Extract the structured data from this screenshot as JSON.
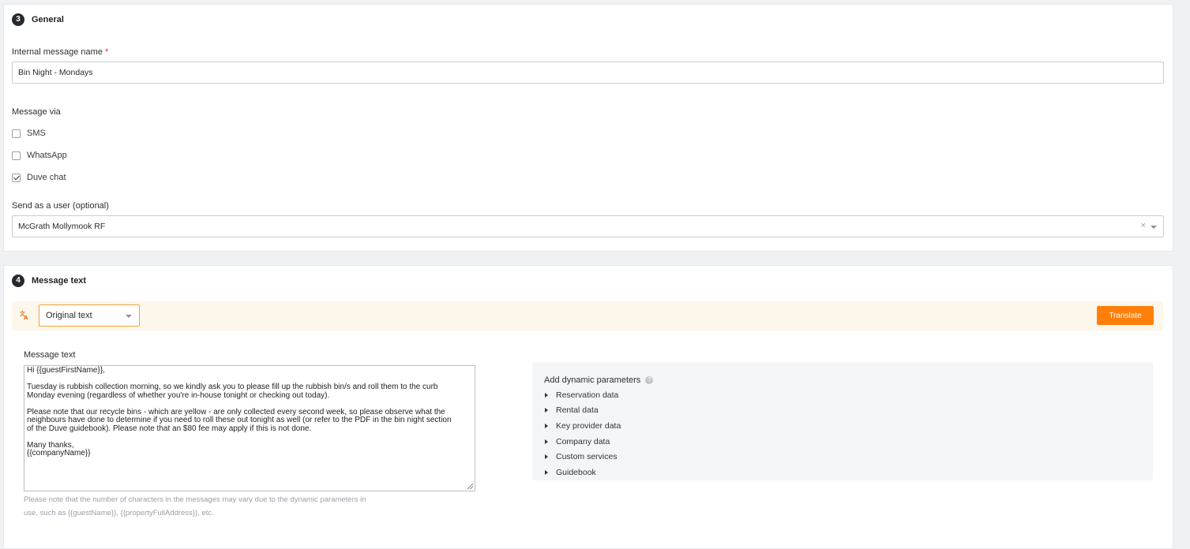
{
  "general": {
    "step": "3",
    "title": "General",
    "name_label": "Internal message name",
    "name_required": "*",
    "name_value": "Bin Night - Mondays",
    "via_label": "Message via",
    "channels": [
      {
        "label": "SMS",
        "checked": false
      },
      {
        "label": "WhatsApp",
        "checked": false
      },
      {
        "label": "Duve chat",
        "checked": true
      }
    ],
    "send_as_label": "Send as a user (optional)",
    "send_as_value": "McGrath Mollymook RF",
    "clear_symbol": "×"
  },
  "message": {
    "step": "4",
    "title": "Message text",
    "translate_icon": "translate-icon",
    "language_value": "Original text",
    "translate_button": "Translate",
    "text_label": "Message text",
    "paragraphs": [
      "Hi {{guestFirstName}},",
      "Tuesday is rubbish collection morning, so we kindly ask you to please fill up the rubbish bin/s and roll them to the curb\nMonday evening (regardless of whether you're in-house tonight or checking out today).",
      "Please note that our recycle bins - which are yellow - are only collected every second week, so please observe what the\nneighbours have done to determine if you need to roll these out tonight as well (or refer to the PDF in the bin night section\nof the Duve guidebook). Please note that an $80 fee may apply if this is not done.",
      "Many thanks,\n{{companyName}}"
    ],
    "note": "Please note that the number of characters in the messages may vary due to the dynamic parameters in use, such as {{guestName}}, {{propertyFullAddress}}, etc.",
    "dynamic_title": "Add dynamic parameters",
    "dynamic_items": [
      "Reservation data",
      "Rental data",
      "Key provider data",
      "Company data",
      "Custom services",
      "Guidebook"
    ]
  },
  "colors": {
    "accent": "#ff7f0a",
    "required": "#e0352f",
    "step_badge": "#262a2e",
    "translate_bar_bg": "#fdf6ea"
  }
}
